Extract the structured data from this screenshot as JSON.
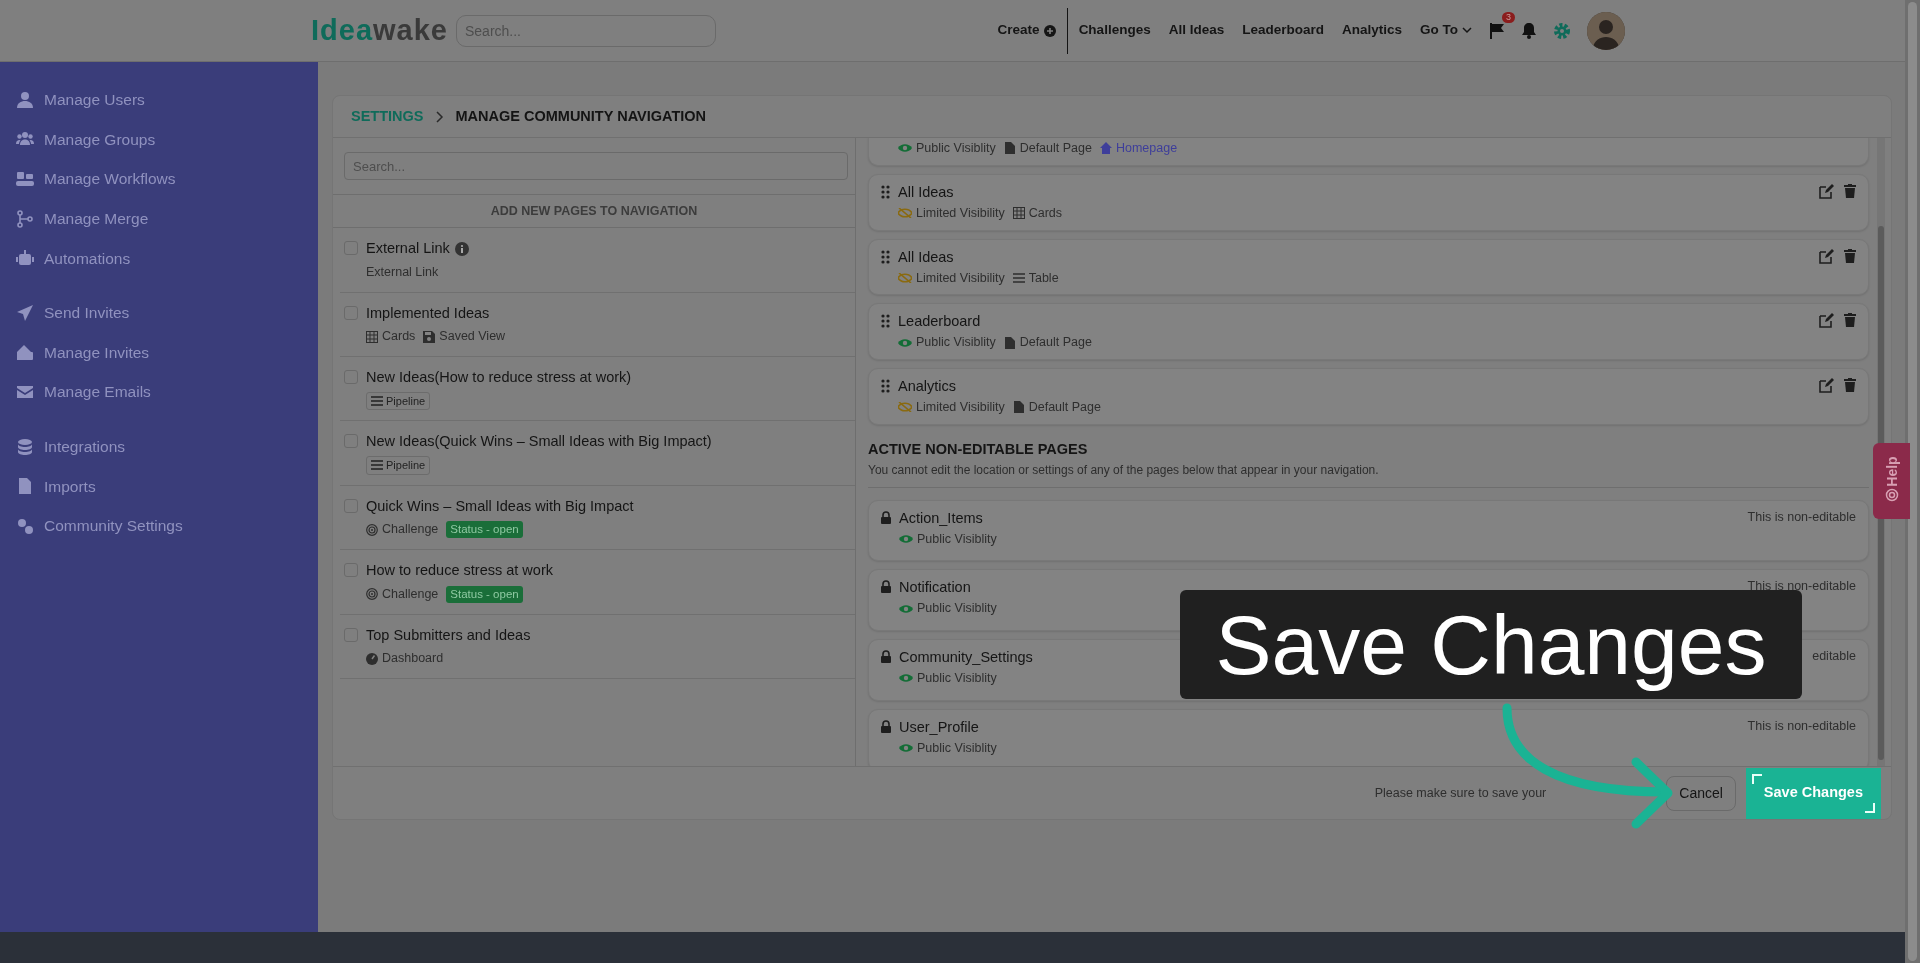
{
  "navbar": {
    "logo": [
      "Idea",
      "wake"
    ],
    "search_placeholder": "Search...",
    "links": [
      {
        "label": "Create",
        "kind": "create"
      },
      {
        "label": "Challenges",
        "kind": "link"
      },
      {
        "label": "All Ideas",
        "kind": "link"
      },
      {
        "label": "Leaderboard",
        "kind": "link"
      },
      {
        "label": "Analytics",
        "kind": "link"
      },
      {
        "label": "Go To",
        "kind": "dropdown"
      }
    ],
    "flag_count": "3"
  },
  "sidebar": {
    "groups": [
      [
        "Manage Users",
        "Manage Groups",
        "Manage Workflows",
        "Manage Merge",
        "Automations"
      ],
      [
        "Send Invites",
        "Manage Invites",
        "Manage Emails"
      ],
      [
        "Integrations",
        "Imports",
        "Community Settings"
      ]
    ]
  },
  "breadcrumb": [
    "SETTINGS",
    "MANAGE COMMUNITY NAVIGATION"
  ],
  "available_pages": {
    "search_placeholder": "Search...",
    "heading": "ADD NEW PAGES TO NAVIGATION",
    "items": [
      {
        "title": "External Link",
        "checked": false,
        "info": true,
        "meta": [
          {
            "kind": "plain",
            "text": "External Link"
          }
        ]
      },
      {
        "title": "Implemented Ideas",
        "checked": false,
        "info": false,
        "meta": [
          {
            "kind": "cards",
            "text": "Cards"
          },
          {
            "kind": "saved",
            "text": "Saved View"
          }
        ]
      },
      {
        "title": "New Ideas(How to reduce stress at work)",
        "checked": false,
        "info": false,
        "meta": [
          {
            "kind": "pipeline",
            "text": "Pipeline"
          }
        ]
      },
      {
        "title": "New Ideas(Quick Wins – Small Ideas with Big Impact)",
        "checked": false,
        "info": false,
        "meta": [
          {
            "kind": "pipeline",
            "text": "Pipeline"
          }
        ]
      },
      {
        "title": "Quick Wins – Small Ideas with Big Impact",
        "checked": false,
        "info": false,
        "meta": [
          {
            "kind": "challenge",
            "text": "Challenge"
          },
          {
            "kind": "status",
            "text": "Status - open"
          }
        ]
      },
      {
        "title": "How to reduce stress at work",
        "checked": false,
        "info": false,
        "meta": [
          {
            "kind": "challenge",
            "text": "Challenge"
          },
          {
            "kind": "status",
            "text": "Status - open"
          }
        ]
      },
      {
        "title": "Top Submitters and Ideas",
        "checked": false,
        "info": false,
        "meta": [
          {
            "kind": "dashboard",
            "text": "Dashboard"
          }
        ]
      }
    ]
  },
  "active_pages": [
    {
      "limited": false,
      "visibility_label": "Public Visiblity",
      "meta": [
        {
          "kind": "page",
          "text": "Default Page"
        },
        {
          "kind": "home",
          "text": "Homepage"
        }
      ]
    },
    {
      "title": "All Ideas",
      "limited": true,
      "visibility_label": "Limited Visibility",
      "meta": [
        {
          "kind": "cards",
          "text": "Cards"
        }
      ]
    },
    {
      "title": "All Ideas",
      "limited": true,
      "visibility_label": "Limited Visibility",
      "meta": [
        {
          "kind": "table",
          "text": "Table"
        }
      ]
    },
    {
      "title": "Leaderboard",
      "limited": false,
      "visibility_label": "Public Visiblity",
      "meta": [
        {
          "kind": "page",
          "text": "Default Page"
        }
      ]
    },
    {
      "title": "Analytics",
      "limited": true,
      "visibility_label": "Limited Visibility",
      "meta": [
        {
          "kind": "page",
          "text": "Default Page"
        }
      ]
    }
  ],
  "non_editable": {
    "title": "ACTIVE NON-EDITABLE PAGES",
    "subtitle": "You cannot edit the location or settings of any of the pages below that appear in your navigation.",
    "items": [
      {
        "title": "Action_Items",
        "limited": false,
        "visibility_label": "Public Visiblity",
        "note": "This is non-editable"
      },
      {
        "title": "Notification",
        "limited": false,
        "visibility_label": "Public Visiblity",
        "note": "This is non-editable"
      },
      {
        "title": "Community_Settings",
        "limited": false,
        "visibility_label": "Public Visiblity",
        "note": "editable"
      },
      {
        "title": "User_Profile",
        "limited": false,
        "visibility_label": "Public Visiblity",
        "note": "This is non-editable"
      }
    ]
  },
  "footer": {
    "note": "Please make sure to save your",
    "cancel": "Cancel",
    "save": "Save Changes"
  },
  "callout": {
    "text": "Save Changes"
  },
  "help_tab": {
    "label": "Help"
  }
}
